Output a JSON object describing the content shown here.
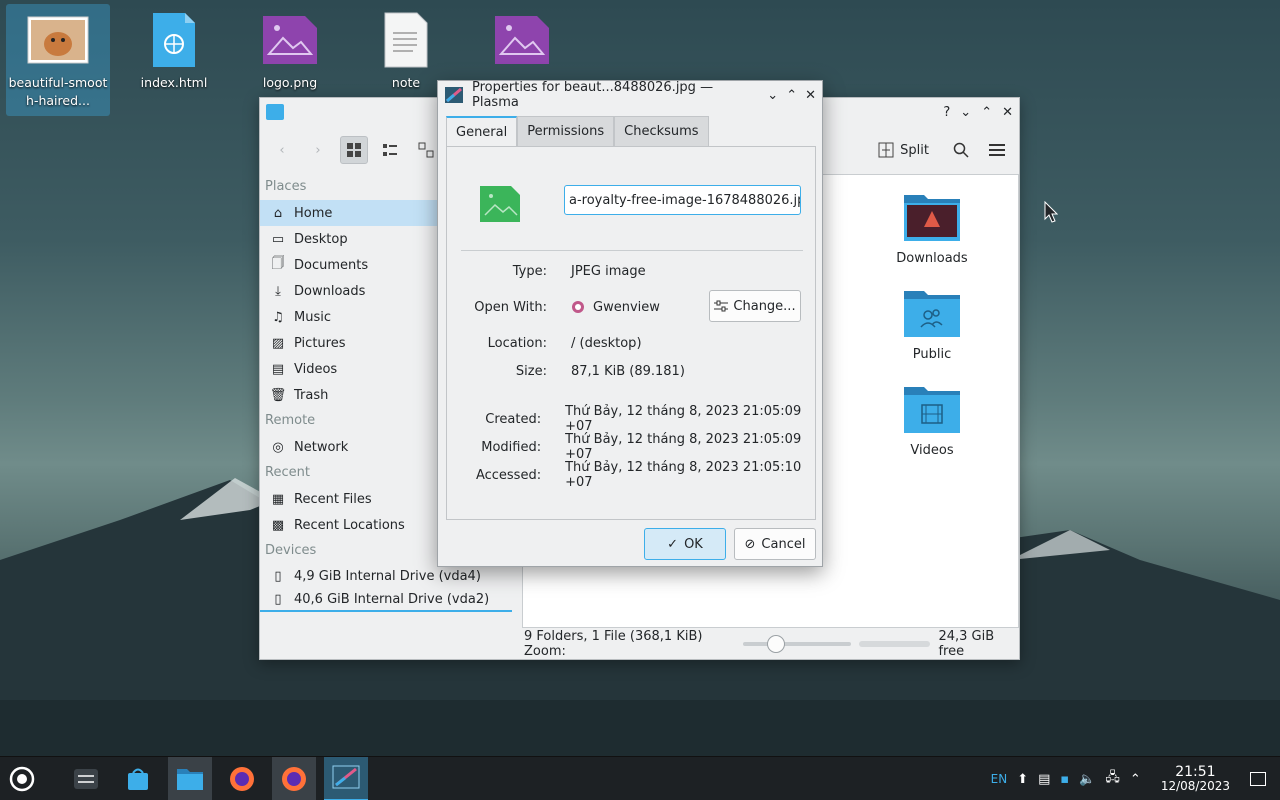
{
  "desktop": {
    "icons": [
      {
        "label": "beautiful-smooth-haired...",
        "icon": "image-thumbnail-icon",
        "selected": true
      },
      {
        "label": "index.html",
        "icon": "html-file-icon"
      },
      {
        "label": "logo.png",
        "icon": "png-image-icon"
      },
      {
        "label": "note",
        "icon": "text-file-icon"
      },
      {
        "label": "",
        "icon": "png-image-icon"
      }
    ]
  },
  "dolphin": {
    "toolbar": {
      "split_label": "Split"
    },
    "places": {
      "sections": {
        "places": "Places",
        "remote": "Remote",
        "recent": "Recent",
        "devices": "Devices"
      },
      "items": [
        "Home",
        "Desktop",
        "Documents",
        "Downloads",
        "Music",
        "Pictures",
        "Videos",
        "Trash"
      ],
      "remote_items": [
        "Network"
      ],
      "recent_items": [
        "Recent Files",
        "Recent Locations"
      ],
      "device_items": [
        "4,9 GiB Internal Drive (vda4)",
        "40,6 GiB Internal Drive (vda2)"
      ]
    },
    "folders": [
      "Downloads",
      "Public",
      "Videos"
    ],
    "status": {
      "summary": "9 Folders, 1 File (368,1 KiB) Zoom:",
      "free": "24,3 GiB free",
      "zoom_level": 0.2
    }
  },
  "dialog": {
    "title": "Properties for beaut...8488026.jpg — Plasma",
    "tabs": [
      "General",
      "Permissions",
      "Checksums"
    ],
    "filename": "a-royalty-free-image-1678488026.jpg",
    "fields": {
      "type_k": "Type:",
      "type_v": "JPEG image",
      "open_k": "Open With:",
      "open_v": "Gwenview",
      "loc_k": "Location:",
      "loc_v": "/ (desktop)",
      "size_k": "Size:",
      "size_v": "87,1 KiB (89.181)",
      "created_k": "Created:",
      "created_v": "Thứ Bảy, 12 tháng 8, 2023 21:05:09 +07",
      "modified_k": "Modified:",
      "modified_v": "Thứ Bảy, 12 tháng 8, 2023 21:05:09 +07",
      "accessed_k": "Accessed:",
      "accessed_v": "Thứ Bảy, 12 tháng 8, 2023 21:05:10 +07"
    },
    "change_label": "Change...",
    "ok_label": "OK",
    "cancel_label": "Cancel"
  },
  "taskbar": {
    "lang": "EN",
    "time": "21:51",
    "date": "12/08/2023"
  },
  "colors": {
    "accent": "#3daee9",
    "folder": "#3daee9",
    "selection": "#c2e0f5"
  }
}
